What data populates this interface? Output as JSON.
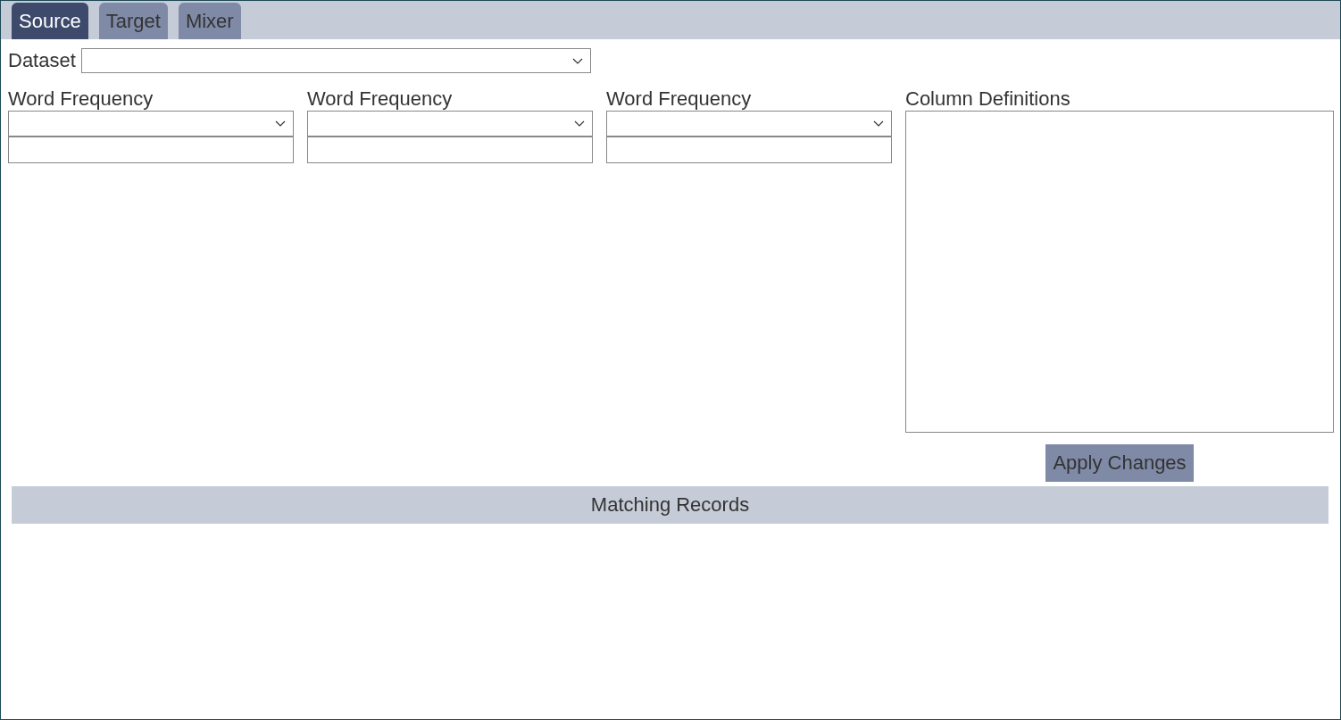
{
  "tabs": [
    {
      "label": "Source",
      "selected": true
    },
    {
      "label": "Target",
      "selected": false
    },
    {
      "label": "Mixer",
      "selected": false
    }
  ],
  "dataset": {
    "label": "Dataset"
  },
  "filters": [
    {
      "label": "Word Frequency"
    },
    {
      "label": "Word Frequency"
    },
    {
      "label": "Word Frequency"
    }
  ],
  "column_definitions": {
    "label": "Column Definitions"
  },
  "apply_button": "Apply Changes",
  "matching_records": {
    "title": "Matching Records"
  }
}
